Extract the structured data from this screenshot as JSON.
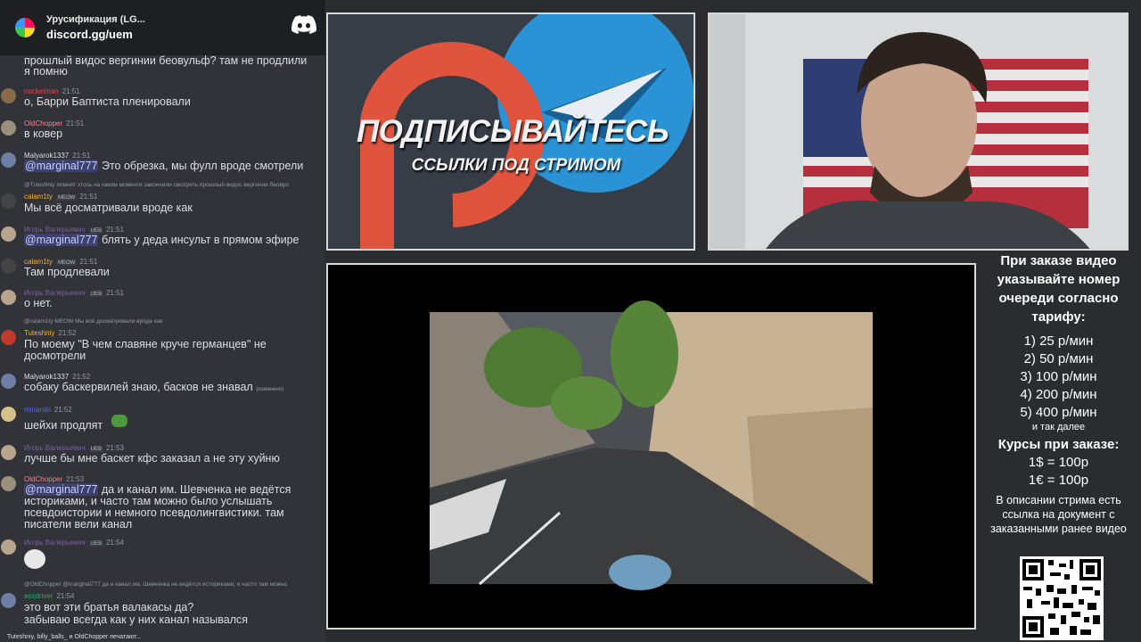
{
  "discord": {
    "server_name": "Урусификация (LG...",
    "invite": "discord.gg/uem"
  },
  "chat": {
    "top_text": "прошлый видос вергинии беовульф? там не продлили",
    "top_text_2": "я помню",
    "messages": [
      {
        "user": "nockelman",
        "time": "21:51",
        "user_color": "#f23f43",
        "text": "о, Барри Баптиста пленировали"
      },
      {
        "user": "OldChopper",
        "time": "21:51",
        "user_color": "#ed8796",
        "text": "в ковер"
      },
      {
        "user": "Malyarok1337",
        "time": "21:51",
        "user_color": "#dbdee1",
        "mention": "@marginal777",
        "text": "Это обрезка, мы фулл вроде смотрели"
      },
      {
        "reply": "@Tuteshniy помнит хтось на каком моменте закончили смотреть прошлый видос вергинии беовул",
        "user": "calam1ty",
        "tag": "MEOW",
        "time": "21:51",
        "user_color": "#f0b232",
        "text": "Мы всё досматривали вроде как"
      },
      {
        "user": "Игорь Валерьевич",
        "tag": "UEB",
        "time": "21:51",
        "user_color": "#7b5ea7",
        "mention": "@marginal777",
        "text": "блять у деда инсульт в прямом эфире"
      },
      {
        "user": "calam1ty",
        "tag": "MEOW",
        "time": "21:51",
        "user_color": "#f0b232",
        "text": "Там продлевали"
      },
      {
        "user": "Игорь Валерьевич",
        "tag": "UEB",
        "time": "21:51",
        "user_color": "#7b5ea7",
        "text": "о нет."
      },
      {
        "reply": "@calam1ty MEOW Мы всё досматривали вроде как",
        "user": "Tuteshniy",
        "time": "21:52",
        "user_color": "#f0b232",
        "text": "По моему \"В чем славяне круче германцев\" не досмотрели"
      },
      {
        "user": "Malyarok1337",
        "time": "21:52",
        "user_color": "#dbdee1",
        "text": "собаку баскервилей знаю, басков не знавал",
        "edited": "(изменено)"
      },
      {
        "user": "minarski",
        "time": "21:52",
        "user_color": "#5865f2",
        "text": "шейхи продлят"
      },
      {
        "user": "Игорь Валерьевич",
        "tag": "UEB",
        "time": "21:53",
        "user_color": "#7b5ea7",
        "text": "лучше бы мне баскет кфс заказал а не эту хуйню"
      },
      {
        "user": "OldChopper",
        "time": "21:53",
        "user_color": "#ed8796",
        "mention": "@marginal777",
        "text": "да и канал им. Шевченка не ведётся историками, и часто там можно было услышать псевдоистории и немного псевдолингвистики. там писатели вели канал"
      },
      {
        "user": "Игорь Валерьевич",
        "tag": "UEB",
        "time": "21:54",
        "user_color": "#7b5ea7",
        "text": ""
      },
      {
        "reply": "@OldChopper @marginal777 да и канал им. Шевченка не ведётся историками, и часто там можно",
        "user": "assdriver",
        "time": "21:54",
        "user_color": "#3ba55c",
        "text": "это вот эти братья валакасы да?",
        "text2": "забываю всегда как у них канал назывался"
      }
    ],
    "typing": "Tuteshniy, billy_balls_ и OldChopper печатают..."
  },
  "promo": {
    "title": "ПОДПИСЫВАЙТЕСЬ",
    "subtitle": "ССЫЛКИ ПОД СТРИМОМ"
  },
  "sidebar": {
    "heading": "При заказе видео указывайте номер очереди согласно тарифу:",
    "tariffs": [
      "1) 25 р/мин",
      "2) 50 р/мин",
      "3) 100 р/мин",
      "4) 200 р/мин",
      "5) 400 р/мин"
    ],
    "etc": "и так далее",
    "rates_heading": "Курсы при заказе:",
    "rates": [
      "1$ = 100р",
      "1€ = 100р"
    ],
    "note": "В описании стрима есть ссылка на документ с заказанными ранее видео"
  }
}
